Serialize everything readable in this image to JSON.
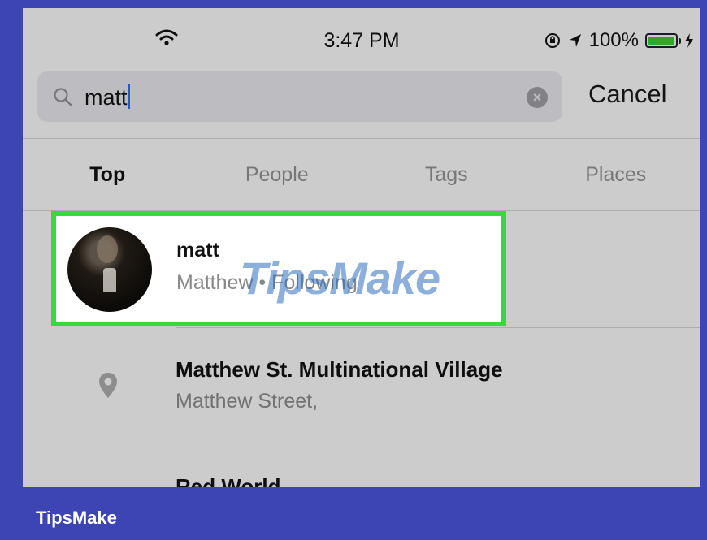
{
  "status_bar": {
    "time": "3:47 PM",
    "battery_percent": "100%",
    "battery_level": 1.0,
    "icons": [
      "wifi-icon",
      "rotation-lock-icon",
      "location-arrow-icon",
      "battery-icon",
      "charging-bolt-icon"
    ]
  },
  "search": {
    "query": "matt",
    "cancel_label": "Cancel"
  },
  "tabs": [
    {
      "label": "Top",
      "active": true
    },
    {
      "label": "People",
      "active": false
    },
    {
      "label": "Tags",
      "active": false
    },
    {
      "label": "Places",
      "active": false
    }
  ],
  "results": [
    {
      "type": "user",
      "name": "matt",
      "subtitle": "Matthew • Following",
      "highlighted": true,
      "highlight_color": "#38d93a"
    },
    {
      "type": "place",
      "name": "Matthew St. Multinational Village",
      "subtitle": "Matthew Street,"
    },
    {
      "type": "place",
      "name": "Red World",
      "subtitle": ""
    }
  ],
  "watermark": "TipsMake",
  "footer": {
    "brand": "TipsMake"
  },
  "colors": {
    "background": "#3d44b4",
    "highlight": "#38d93a",
    "battery": "#3ec43a"
  }
}
